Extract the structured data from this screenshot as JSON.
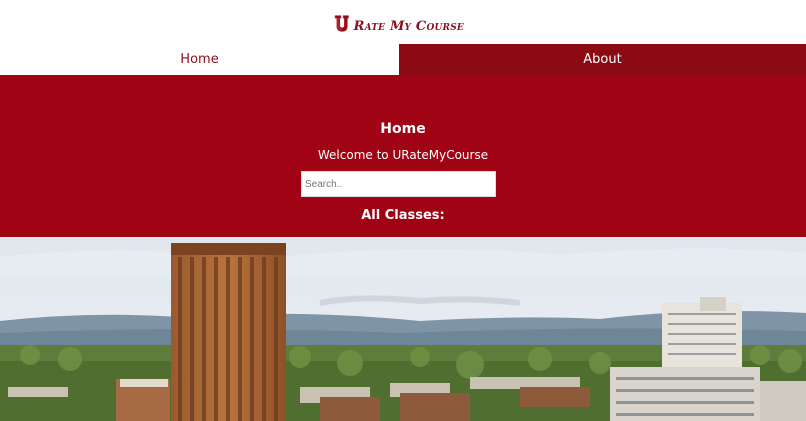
{
  "logo": {
    "text": "Rate My Course",
    "letter": "U",
    "colors": {
      "maroon": "#8a0e1c",
      "outline": "#c41f2f"
    }
  },
  "nav": {
    "items": [
      {
        "label": "Home",
        "active": true
      },
      {
        "label": "About",
        "active": false
      }
    ]
  },
  "hero": {
    "title": "Home",
    "welcome": "Welcome to URateMyCourse",
    "search": {
      "placeholder": "Search..",
      "value": ""
    },
    "classes_heading": "All Classes:"
  },
  "colors": {
    "hero_bg": "#a00414",
    "about_tab_bg": "#8c0a13"
  }
}
